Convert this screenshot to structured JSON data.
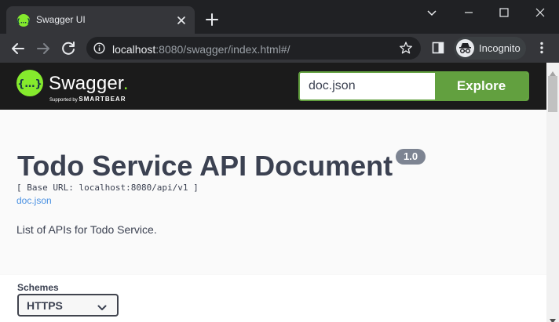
{
  "browser": {
    "tab": {
      "title": "Swagger UI",
      "favicon": "swagger-favicon-icon"
    },
    "url": {
      "host": "localhost",
      "path": ":8080/swagger/index.html#/"
    },
    "profile": {
      "label": "Incognito"
    },
    "icons": [
      "back-icon",
      "forward-icon",
      "reload-icon",
      "info-icon",
      "star-icon",
      "side-panel-icon",
      "incognito-icon",
      "menu-icon",
      "close-icon",
      "plus-icon",
      "minimize-icon",
      "maximize-icon",
      "chevron-down-icon"
    ]
  },
  "swagger": {
    "logo": {
      "text": "Swagger",
      "supported_by": "Supported by",
      "company": "SMARTBEAR"
    },
    "search": {
      "value": "doc.json",
      "button": "Explore"
    },
    "info": {
      "title": "Todo Service API Document",
      "version": "1.0",
      "base_url": "[ Base URL: localhost:8080/api/v1 ]",
      "doc_link": "doc.json",
      "description": "List of APIs for Todo Service."
    },
    "schemes": {
      "label": "Schemes",
      "selected": "HTTPS"
    }
  },
  "colors": {
    "brand_green": "#85ea2d",
    "explore_button": "#62a03f",
    "topbar": "#1b1b1b",
    "text": "#3b4151",
    "link": "#4990e2",
    "version_badge": "#7d8492",
    "chrome_bg": "#202124",
    "chrome_toolbar": "#35363a"
  }
}
